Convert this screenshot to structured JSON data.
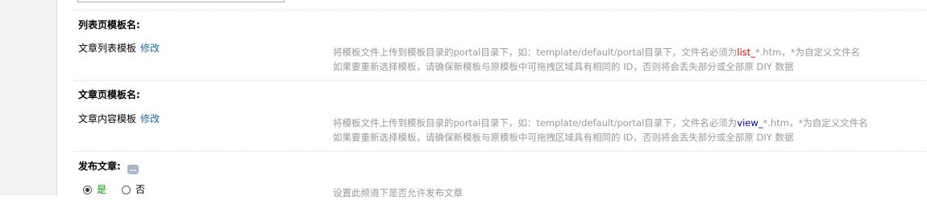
{
  "list_template": {
    "title": "列表页模板名:",
    "value": "文章列表模板",
    "edit_label": "修改",
    "tip_prefix": "将模板文件上传到模板目录的portal目录下，如：template/default/portal目录下，文件名必须为",
    "tip_highlight": "list_",
    "tip_suffix": "*.htm，*为自定义文件名",
    "tip_line2": "如果要重新选择模板，请确保新模板与原模板中可拖拽区域具有相同的 ID，否则将会丢失部分或全部原 DIY 数据"
  },
  "view_template": {
    "title": "文章页模板名:",
    "value": "文章内容模板",
    "edit_label": "修改",
    "tip_prefix": "将模板文件上传到模板目录的portal目录下，如：template/default/portal目录下，文件名必须为",
    "tip_highlight": "view_",
    "tip_suffix": "*.htm，*为自定义文件名",
    "tip_line2": "如果要重新选择模板，请确保新模板与原模板中可拖拽区域具有相同的 ID，否则将会丢失部分或全部原 DIY 数据"
  },
  "publish_article": {
    "title": "发布文章:",
    "help_icon": "help-icon",
    "options": [
      "是",
      "否"
    ],
    "selected": "是",
    "tip": "设置此频道下是否允许发布文章"
  },
  "colors": {
    "link": "#2366a8",
    "tip_text": "#999999",
    "highlight_red": "#cc0000",
    "highlight_blue": "#000099",
    "selected_option": "#009900"
  }
}
